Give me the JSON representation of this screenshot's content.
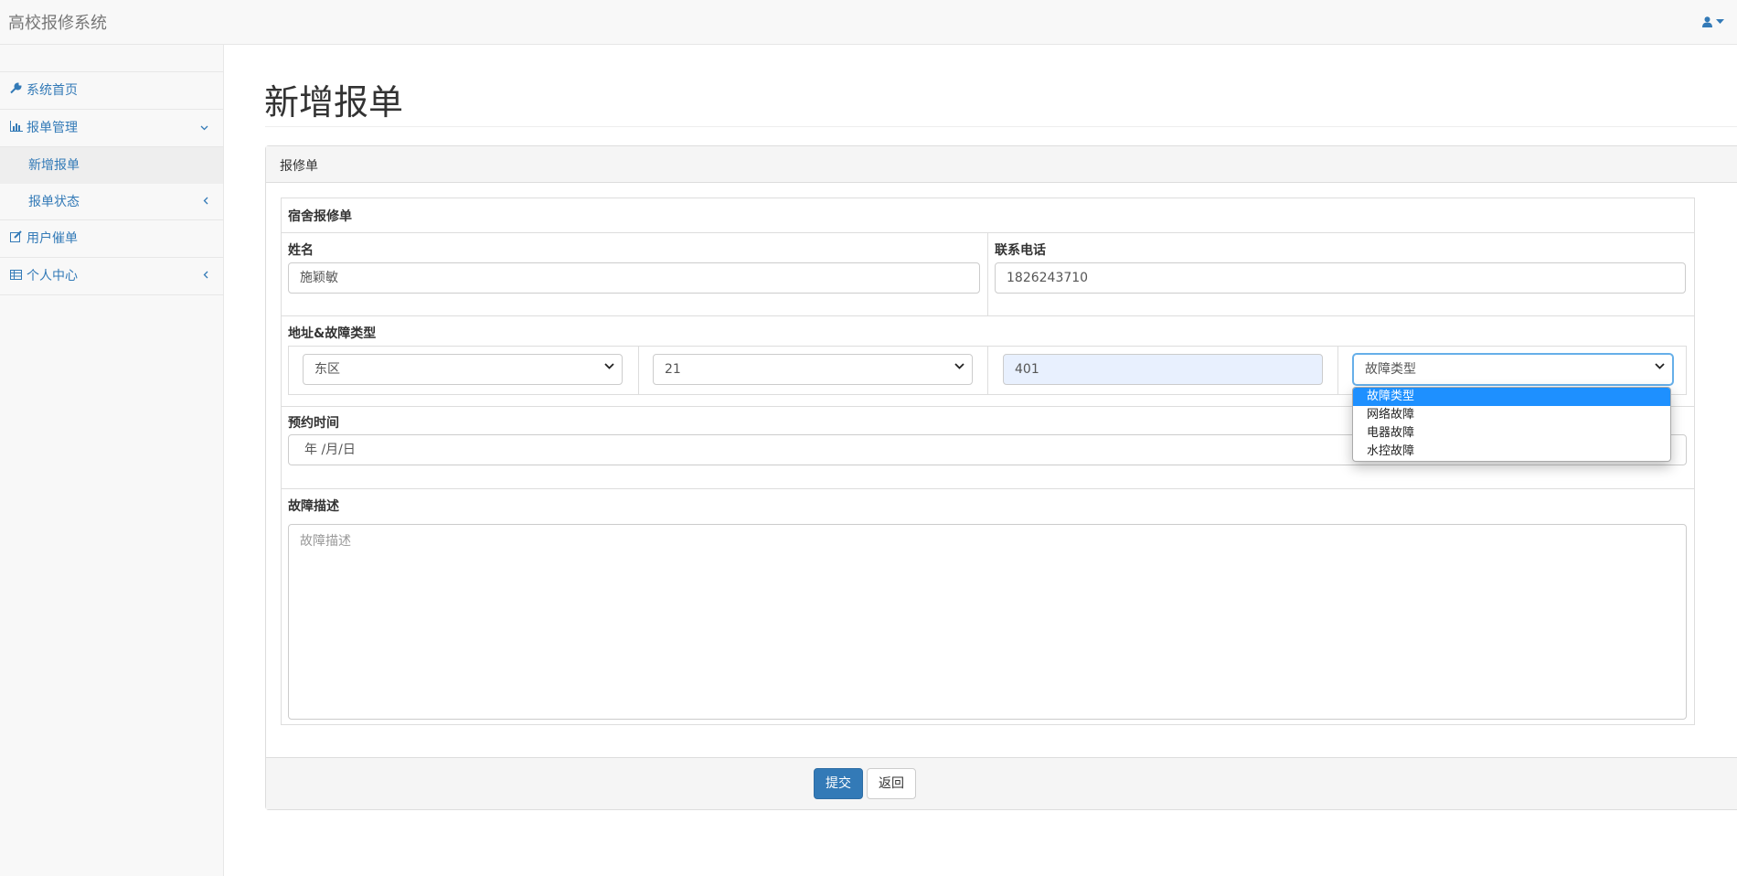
{
  "navbar": {
    "brand": "高校报修系统"
  },
  "sidebar": {
    "items": [
      {
        "label": "系统首页"
      },
      {
        "label": "报单管理"
      },
      {
        "label": "新增报单"
      },
      {
        "label": "报单状态"
      },
      {
        "label": "用户催单"
      },
      {
        "label": "个人中心"
      }
    ]
  },
  "main": {
    "title": "新增报单",
    "panel_heading": "报修单",
    "form": {
      "section_title": "宿舍报修单",
      "name_label": "姓名",
      "name_value": "施颖敏",
      "phone_label": "联系电话",
      "phone_value": "1826243710",
      "address_label": "地址&故障类型",
      "area_value": "东区",
      "building_value": "21",
      "room_value": "401",
      "fault_type_value": "故障类型",
      "date_label": "预约时间",
      "date_placeholder": "年 /月/日",
      "desc_label": "故障描述",
      "desc_placeholder": "故障描述"
    },
    "fault_options": [
      "故障类型",
      "网络故障",
      "电器故障",
      "水控故障"
    ],
    "submit_label": "提交",
    "back_label": "返回"
  },
  "colors": {
    "link": "#337ab7",
    "primary": "#337ab7",
    "option_highlight": "#1e90ff"
  }
}
